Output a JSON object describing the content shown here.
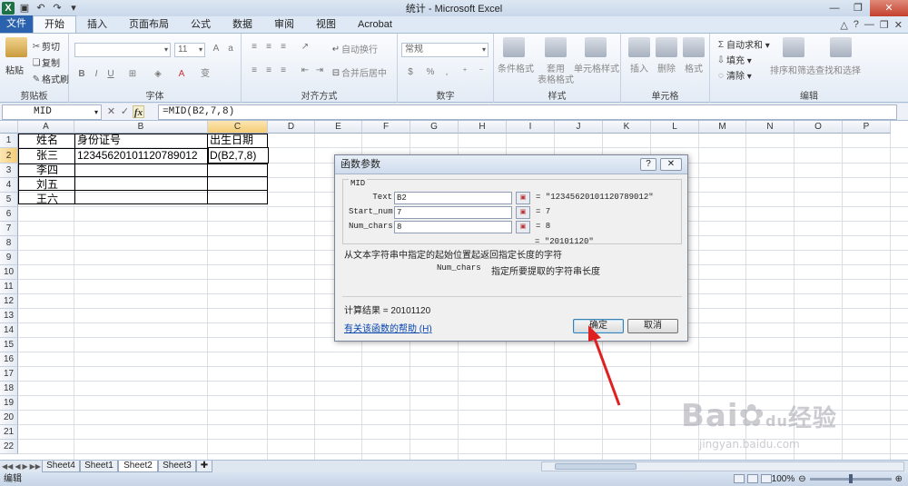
{
  "window": {
    "title": "统计 - Microsoft Excel"
  },
  "tabs": [
    "文件",
    "开始",
    "插入",
    "页面布局",
    "公式",
    "数据",
    "审阅",
    "视图",
    "Acrobat"
  ],
  "ribbon": {
    "clipboard": {
      "paste": "粘贴",
      "cut": "剪切",
      "copy": "复制",
      "format_painter": "格式刷",
      "label": "剪贴板"
    },
    "font": {
      "size": "11",
      "label": "字体"
    },
    "alignment": {
      "wrap": "自动换行",
      "merge": "合并后居中",
      "label": "对齐方式"
    },
    "number": {
      "format": "常规",
      "label": "数字"
    },
    "styles": {
      "conditional": "条件格式",
      "table1": "套用",
      "table2": "表格格式",
      "cell_styles": "单元格样式",
      "label": "样式"
    },
    "cells": {
      "insert": "插入",
      "delete": "删除",
      "format": "格式",
      "label": "单元格"
    },
    "editing": {
      "autosum": "自动求和",
      "fill": "填充",
      "clear": "清除",
      "sort_filter": "排序和筛选",
      "find_select": "查找和选择",
      "label": "编辑"
    }
  },
  "formula_bar": {
    "name_box": "MID",
    "formula": "=MID(B2,7,8)"
  },
  "columns": [
    "A",
    "B",
    "C",
    "D",
    "E",
    "F",
    "G",
    "H",
    "I",
    "J",
    "K",
    "L",
    "M",
    "N",
    "O",
    "P"
  ],
  "rows": [
    "1",
    "2",
    "3",
    "4",
    "5",
    "6",
    "7",
    "8",
    "9",
    "10",
    "11",
    "12",
    "13",
    "14",
    "15",
    "16",
    "17",
    "18",
    "19",
    "20",
    "21",
    "22"
  ],
  "cells": {
    "A1": "姓名",
    "B1": "身份证号",
    "C1": "出生日期",
    "A2": "张三",
    "B2": "123456201011207890­12",
    "C2": "D(B2,7,8)",
    "A3": "李四",
    "A4": "刘五",
    "A5": "王六"
  },
  "dialog": {
    "title": "函数参数",
    "help_btn": "?",
    "close_btn": "✕",
    "function_name": "MID",
    "args": [
      {
        "label": "Text",
        "value": "B2",
        "result": "= \"123456201011207890­12\""
      },
      {
        "label": "Start_num",
        "value": "7",
        "result": "= 7"
      },
      {
        "label": "Num_chars",
        "value": "8",
        "result": "= 8"
      }
    ],
    "overall_result": "= \"20101120\"",
    "description": "从文本字符串中指定的起始位置起返回指定长度的字符",
    "arg_help_name": "Num_chars",
    "arg_help": "指定所要提取的字符串长度",
    "calc_result": "计算结果 =  20101120",
    "help_link": "有关该函数的帮助 (H)",
    "ok": "确定",
    "cancel": "取消"
  },
  "sheets": [
    "Sheet4",
    "Sheet1",
    "Sheet2",
    "Sheet3"
  ],
  "active_sheet": "Sheet2",
  "status": {
    "mode": "编辑",
    "zoom": "100%"
  },
  "watermark": {
    "brand": "Bai",
    "brand2": "经验",
    "url": "jingyan.baidu.com"
  }
}
